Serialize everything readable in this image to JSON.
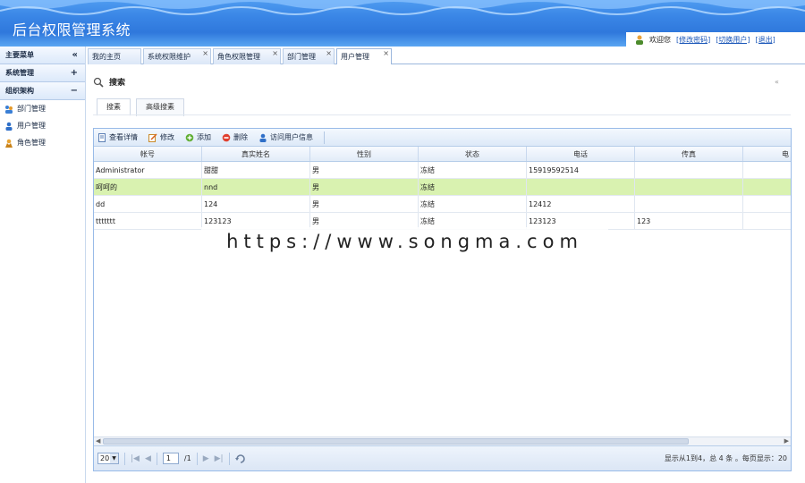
{
  "app": {
    "title": "后台权限管理系统"
  },
  "userbar": {
    "welcome": "欢迎您",
    "change_password": "[修改密码]",
    "switch_user": "[切换用户]",
    "logout": "[退出]"
  },
  "sidebar": {
    "main_menu": {
      "label": "主要菜单",
      "toggle": "«"
    },
    "groups": [
      {
        "label": "系统管理",
        "toggle": "+"
      },
      {
        "label": "组织架构",
        "toggle": "−"
      }
    ],
    "items": [
      {
        "label": "部门管理",
        "icon": "org-icon"
      },
      {
        "label": "用户管理",
        "icon": "user-icon"
      },
      {
        "label": "角色管理",
        "icon": "role-icon"
      }
    ]
  },
  "tabs": [
    {
      "label": "我的主页",
      "active": false,
      "closable": false
    },
    {
      "label": "系统权限维护",
      "active": false,
      "closable": true
    },
    {
      "label": "角色权限管理",
      "active": false,
      "closable": true
    },
    {
      "label": "部门管理",
      "active": false,
      "closable": true
    },
    {
      "label": "用户管理",
      "active": true,
      "closable": true
    }
  ],
  "search": {
    "title": "搜索",
    "collapse_icon": "«",
    "tabs": [
      {
        "label": "搜素",
        "active": true
      },
      {
        "label": "高级搜素",
        "active": false
      }
    ]
  },
  "toolbar": {
    "view_details": "查看详情",
    "edit": "修改",
    "add": "添加",
    "delete": "删除",
    "view_user_info": "访问用户信息"
  },
  "table": {
    "columns": [
      "帐号",
      "真实姓名",
      "性别",
      "状态",
      "电话",
      "传真",
      "电"
    ],
    "rows": [
      [
        "Administrator",
        "甜甜",
        "男",
        "冻结",
        "15919592514",
        "",
        ""
      ],
      [
        "呵呵的",
        "nnd",
        "男",
        "冻结",
        "",
        "",
        ""
      ],
      [
        "dd",
        "124",
        "男",
        "冻结",
        "12412",
        "",
        ""
      ],
      [
        "ttttttt",
        "123123",
        "男",
        "冻结",
        "123123",
        "123",
        ""
      ]
    ],
    "selected_row": 1
  },
  "pager": {
    "page_size": "20",
    "first": "|◀",
    "prev": "◀",
    "page_input": "1",
    "of_pages": "/1",
    "next": "▶",
    "last": "▶|",
    "info": "显示从1到4，总 4 条 。每页显示：20"
  },
  "watermark": "https://www.songma.com",
  "colors": {
    "header": "#3a86e6",
    "selected_row": "#d9f2b0",
    "border": "#99bbe8"
  }
}
